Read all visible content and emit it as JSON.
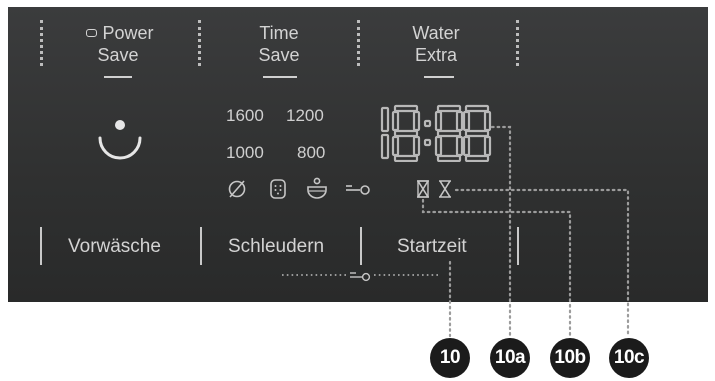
{
  "options": {
    "power_save_line1": "Power",
    "power_save_line2": "Save",
    "time_save_line1": "Time",
    "time_save_line2": "Save",
    "water_extra_line1": "Water",
    "water_extra_line2": "Extra"
  },
  "spin_speeds": [
    "1600",
    "1200",
    "1000",
    "800"
  ],
  "display": {
    "digits": "18:88"
  },
  "buttons": {
    "prewash": "Vorwäsche",
    "spin": "Schleudern",
    "start_time": "Startzeit"
  },
  "callouts": [
    "10",
    "10a",
    "10b",
    "10c"
  ],
  "icons": [
    "no-spin-icon",
    "drum-icon",
    "rinse-hold-icon",
    "child-lock-icon",
    "hourglass-icon",
    "hourglass-icon"
  ],
  "colors": {
    "panel": "#333434",
    "text": "#d3d3d3",
    "badge": "#1b1b1b"
  }
}
